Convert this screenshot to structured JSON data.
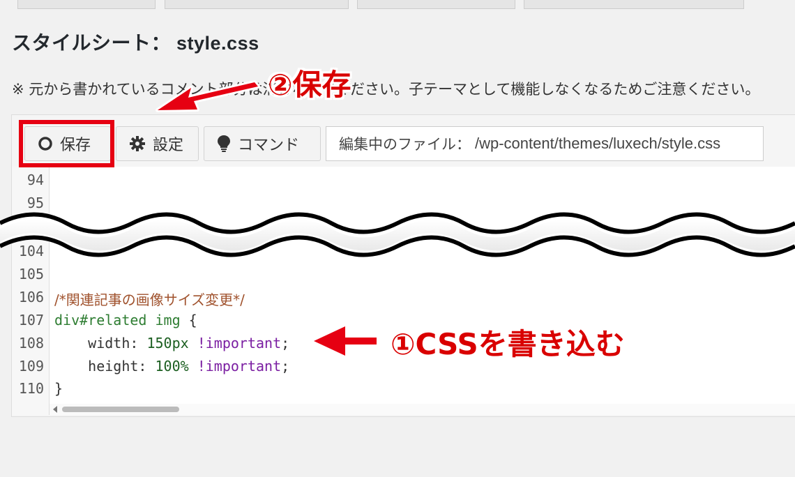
{
  "page": {
    "title": "スタイルシート：",
    "filename": "style.css",
    "note": "※ 元から書かれているコメント部分は消さないでください。子テーマとして機能しなくなるためご注意ください。"
  },
  "toolbar": {
    "save_label": "保存",
    "settings_label": "設定",
    "command_label": "コマンド",
    "file_label": "編集中のファイル：",
    "file_path": "/wp-content/themes/luxech/style.css"
  },
  "editor": {
    "lines": [
      {
        "num": "94",
        "text": ""
      },
      {
        "num": "95",
        "text": ""
      },
      {
        "num": "104",
        "text": ""
      },
      {
        "num": "105",
        "text": ""
      },
      {
        "num": "106",
        "text": "/*関連記事の画像サイズ変更*/"
      },
      {
        "num": "107",
        "text": "div#related img {"
      },
      {
        "num": "108",
        "text": "    width: 150px !important;"
      },
      {
        "num": "109",
        "text": "    height: 100% !important;"
      },
      {
        "num": "110",
        "text": "}"
      }
    ],
    "tokens": {
      "l107_sel": "div#related img",
      "l107_brace": " {",
      "l108_prop": "    width: ",
      "l108_val": "150px",
      "l108_imp": " !important",
      "l108_end": ";",
      "l109_prop": "    height: ",
      "l109_val": "100%",
      "l109_imp": " !important",
      "l109_end": ";",
      "l110": "}"
    }
  },
  "annotations": {
    "step2": "②保存",
    "step1": "①CSSを書き込む",
    "color": "#d90000"
  },
  "icons": [
    "circle-icon",
    "gear-icon",
    "lightbulb-icon"
  ]
}
